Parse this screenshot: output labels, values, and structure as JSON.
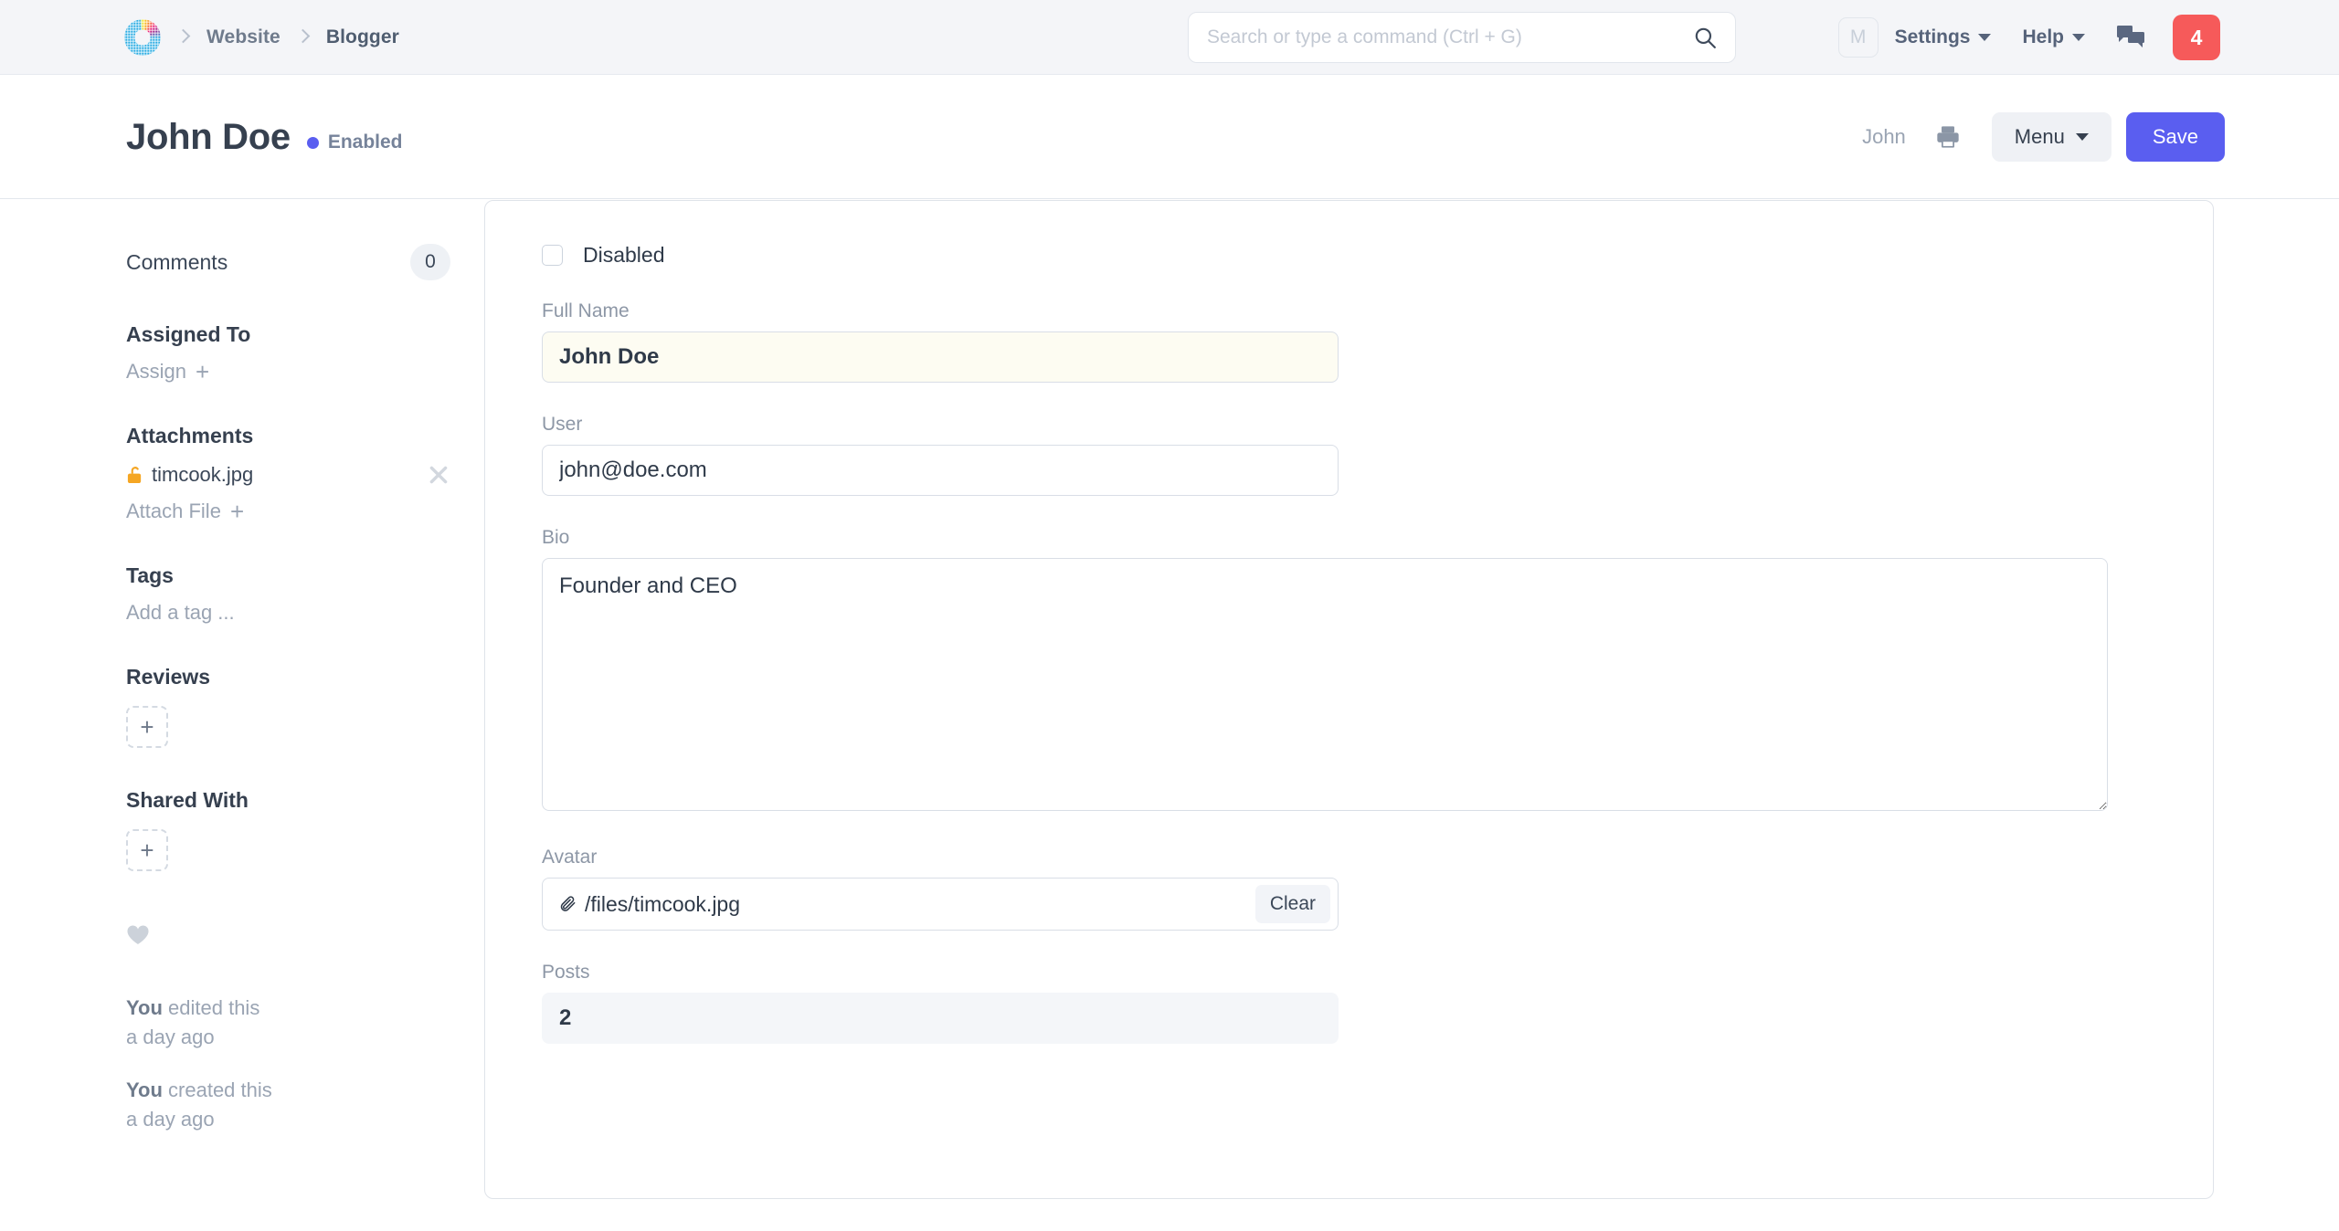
{
  "navbar": {
    "logo_icon": "frappe-logo-icon",
    "breadcrumbs": [
      {
        "label": "Website"
      },
      {
        "label": "Blogger"
      }
    ],
    "search": {
      "placeholder": "Search or type a command (Ctrl + G)",
      "value": "",
      "icon": "search-icon"
    },
    "avatar_initial": "M",
    "settings_label": "Settings",
    "help_label": "Help",
    "chat_icon": "chat-bubbles-icon",
    "notification_count": "4",
    "notification_color": "#f65a5a"
  },
  "titlebar": {
    "doc_title": "John Doe",
    "status_label": "Enabled",
    "status_color": "#5a5ef0",
    "owner_label": "John",
    "print_icon": "printer-icon",
    "menu_label": "Menu",
    "save_label": "Save",
    "save_color": "#5a5ef0"
  },
  "sidebar": {
    "comments_label": "Comments",
    "comments_count": "0",
    "assigned_to_label": "Assigned To",
    "assign_link": "Assign",
    "attachments_label": "Attachments",
    "attachment_name": "timcook.jpg",
    "attachment_lock_icon": "unlocked-padlock-icon",
    "attachment_remove_icon": "close-icon",
    "attach_file_link": "Attach File",
    "tags_label": "Tags",
    "add_tag_placeholder": "Add a tag ...",
    "reviews_label": "Reviews",
    "reviews_add": "+",
    "shared_with_label": "Shared With",
    "shared_add": "+",
    "like_icon": "heart-icon",
    "activity": [
      {
        "actor": "You",
        "action": " edited this",
        "time": "a day ago"
      },
      {
        "actor": "You",
        "action": " created this",
        "time": "a day ago"
      }
    ]
  },
  "form": {
    "disabled_label": "Disabled",
    "disabled_checked": false,
    "fields": {
      "full_name": {
        "label": "Full Name",
        "value": "John Doe",
        "modified": true
      },
      "user": {
        "label": "User",
        "value": "john@doe.com"
      },
      "bio": {
        "label": "Bio",
        "value": "Founder and CEO"
      },
      "avatar": {
        "label": "Avatar",
        "value": "/files/timcook.jpg",
        "clip_icon": "paperclip-icon",
        "clear_label": "Clear"
      },
      "posts": {
        "label": "Posts",
        "value": "2",
        "readonly": true
      }
    }
  }
}
